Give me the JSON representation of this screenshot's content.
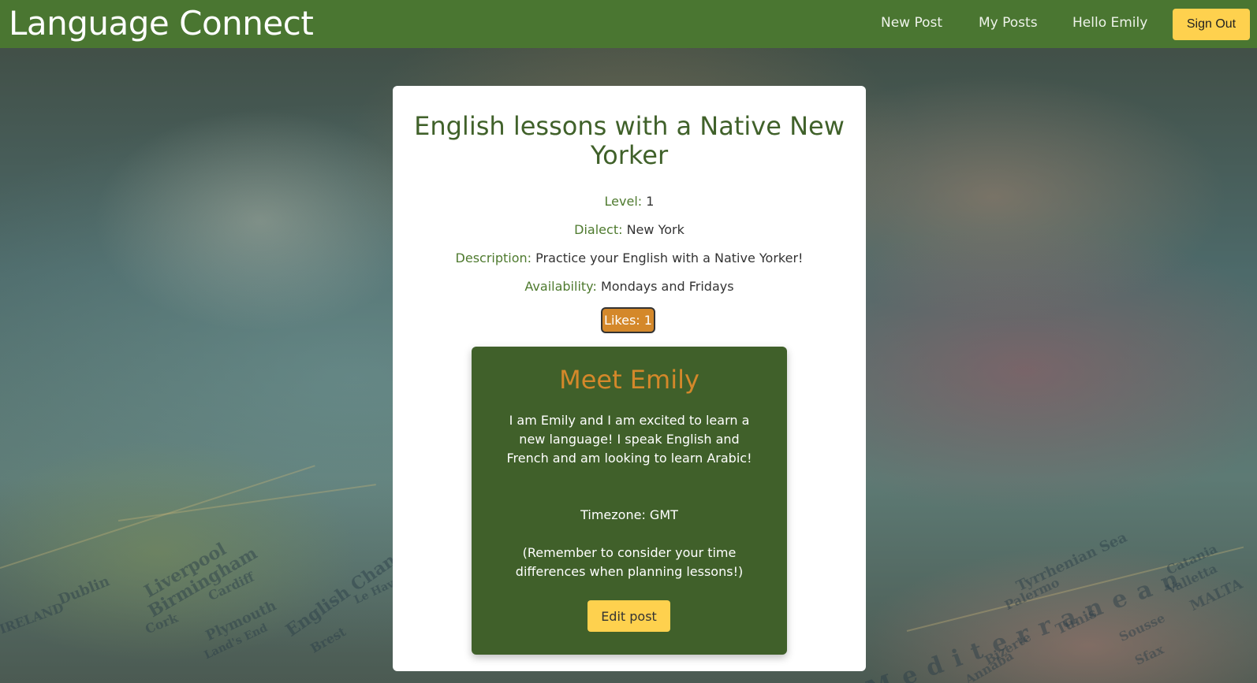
{
  "navbar": {
    "brand": "Language Connect",
    "links": [
      "New Post",
      "My Posts",
      "Hello Emily"
    ],
    "sign_out": "Sign Out"
  },
  "post": {
    "title": "English lessons with a Native New Yorker",
    "level_label": "Level:",
    "level_value": "1",
    "dialect_label": "Dialect:",
    "dialect_value": "New York",
    "description_label": "Description:",
    "description_value": "Practice your English with a Native Yorker!",
    "availability_label": "Availability:",
    "availability_value": "Mondays and Fridays",
    "likes": "Likes: 1"
  },
  "profile": {
    "heading": "Meet Emily",
    "bio": "I am Emily and I am excited to learn a new language! I speak English and French and am looking to learn Arabic!",
    "timezone": "Timezone: GMT",
    "reminder": "(Remember to consider your time differences when planning lessons!)",
    "edit_button": "Edit post"
  },
  "background_map_labels": [
    "IRELAND",
    "Dublin",
    "Liverpool",
    "Birmingham",
    "Cardiff",
    "Plymouth",
    "English Channel",
    "Cork",
    "Land's End",
    "Brest",
    "Le Havre",
    "Mediterranean",
    "Tunis",
    "Palermo",
    "Tyrrhenian Sea",
    "Sousse",
    "Sfax",
    "Bizerte",
    "Annaba",
    "MALTA",
    "Valletta",
    "Catania"
  ],
  "colors": {
    "navbar": "#4a7631",
    "accent_yellow": "#fed14e",
    "title_green": "#40612a",
    "profile_bg": "#40602a",
    "orange": "#d4882a"
  }
}
